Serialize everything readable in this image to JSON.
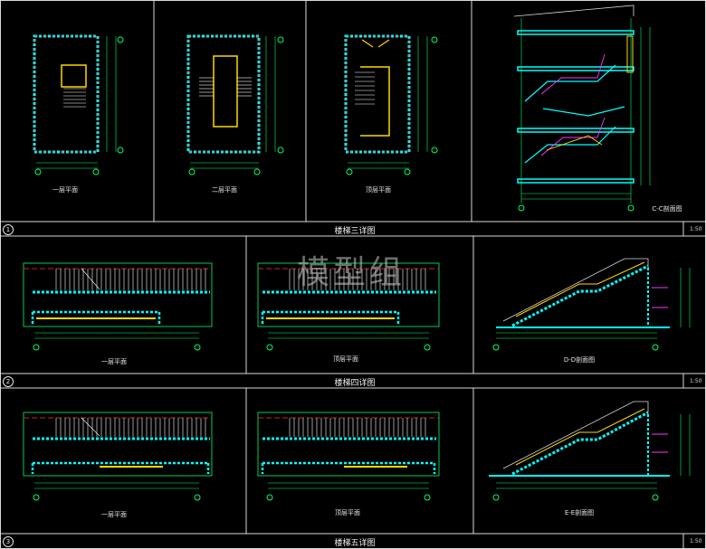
{
  "colors": {
    "background": "#000000",
    "frame": "#d9d9d9",
    "wall": "#00ffff",
    "dim": "#00ff66",
    "axis": "#ff3333",
    "stair": "#ffd700",
    "rail": "#ff33ff"
  },
  "watermark": "模型组",
  "sections": [
    {
      "index": "1",
      "title": "楼梯三详图",
      "scale": "1:50",
      "drawings": [
        {
          "label": "一层平面"
        },
        {
          "label": "二层平面"
        },
        {
          "label": "顶层平面"
        },
        {
          "label": "C-C剖面图"
        }
      ]
    },
    {
      "index": "2",
      "title": "楼梯四详图",
      "scale": "1:50",
      "drawings": [
        {
          "label": "一层平面"
        },
        {
          "label": "顶层平面"
        },
        {
          "label": "D-D剖面图"
        }
      ]
    },
    {
      "index": "3",
      "title": "楼梯五详图",
      "scale": "1:50",
      "drawings": [
        {
          "label": "一层平面"
        },
        {
          "label": "顶层平面"
        },
        {
          "label": "E-E剖面图"
        }
      ]
    }
  ]
}
